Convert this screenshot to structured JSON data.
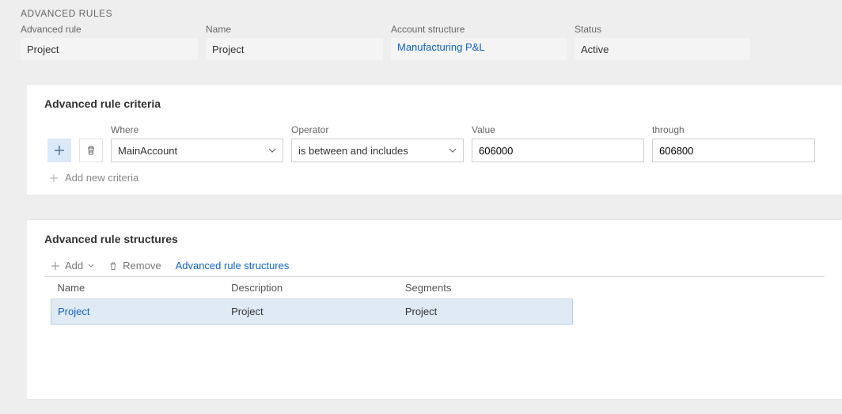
{
  "header": {
    "section_label": "ADVANCED RULES",
    "fields": {
      "advanced_rule": {
        "label": "Advanced rule",
        "value": "Project"
      },
      "name": {
        "label": "Name",
        "value": "Project"
      },
      "account_struct": {
        "label": "Account structure",
        "value": "Manufacturing P&L"
      },
      "status": {
        "label": "Status",
        "value": "Active"
      }
    }
  },
  "criteria_panel": {
    "title": "Advanced rule criteria",
    "labels": {
      "where": "Where",
      "operator": "Operator",
      "value": "Value",
      "through": "through"
    },
    "row": {
      "where": "MainAccount",
      "operator": "is between and includes",
      "value": "606000",
      "through": "606800"
    },
    "add_new": "Add new criteria"
  },
  "structures_panel": {
    "title": "Advanced rule structures",
    "toolbar": {
      "add": "Add",
      "remove": "Remove",
      "link": "Advanced rule structures"
    },
    "columns": {
      "name": "Name",
      "description": "Description",
      "segments": "Segments"
    },
    "rows": [
      {
        "name": "Project",
        "description": "Project",
        "segments": "Project"
      }
    ]
  }
}
